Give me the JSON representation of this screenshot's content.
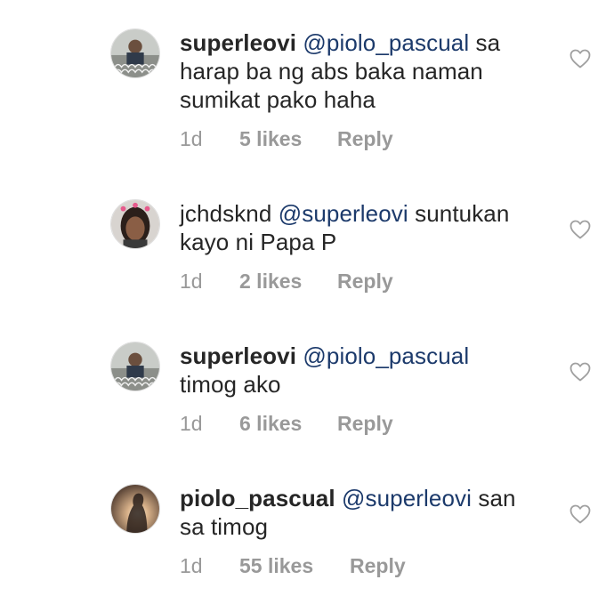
{
  "comments": [
    {
      "username": "superleovi",
      "mention": "@piolo_pascual",
      "text_line1": "sa",
      "text_rest": "harap ba ng abs baka naman sumikat pako haha",
      "time": "1d",
      "likes": "5 likes",
      "reply": "Reply",
      "avatar": "avatar-man-fence-photo"
    },
    {
      "username": "jchdsknd",
      "mention": "@superleovi",
      "text_line1": "suntukan",
      "text_rest": "kayo ni Papa P",
      "time": "1d",
      "likes": "2 likes",
      "reply": "Reply",
      "avatar": "avatar-woman-hearts-photo"
    },
    {
      "username": "superleovi",
      "mention": "@piolo_pascual",
      "text_line1": "",
      "text_rest": "timog ako",
      "time": "1d",
      "likes": "6 likes",
      "reply": "Reply",
      "avatar": "avatar-man-fence-photo"
    },
    {
      "username": "piolo_pascual",
      "mention": "@superleovi",
      "text_line1": "san",
      "text_rest": "sa timog",
      "time": "1d",
      "likes": "55 likes",
      "reply": "Reply",
      "avatar": "avatar-silhouette-sunset-photo"
    }
  ],
  "icons": {
    "like": "heart-outline-icon"
  },
  "colors": {
    "text": "#262626",
    "mention": "#1c3a6b",
    "meta": "#999999",
    "heart": "#a0a0a0",
    "background": "#ffffff"
  }
}
